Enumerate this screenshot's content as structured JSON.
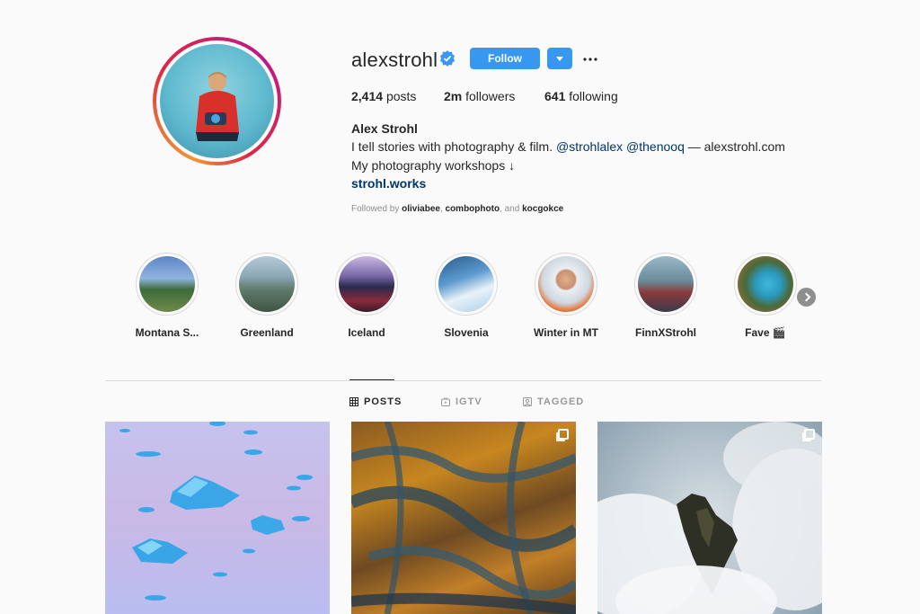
{
  "profile": {
    "username": "alexstrohl",
    "verified_icon": "verified-badge-icon",
    "follow_label": "Follow",
    "posts_count": "2,414",
    "posts_label": "posts",
    "followers_count": "2m",
    "followers_label": "followers",
    "following_count": "641",
    "following_label": "following",
    "full_name": "Alex Strohl",
    "bio_line1_prefix": "I tell stories with photography & film. ",
    "mention1": "@strohlalex",
    "mention2": "@thenooq",
    "bio_line1_suffix": " — alexstrohl.com",
    "bio_line2": "My photography workshops ↓",
    "link": "strohl.works",
    "followed_by_prefix": "Followed by ",
    "followed_by_1": "oliviabee",
    "followed_by_2": "combophoto",
    "followed_by_3": "kocgokce",
    "followed_by_sep": ", ",
    "followed_by_and": ", and "
  },
  "highlights": [
    {
      "label": "Montana S..."
    },
    {
      "label": "Greenland"
    },
    {
      "label": "Iceland"
    },
    {
      "label": "Slovenia"
    },
    {
      "label": "Winter in MT"
    },
    {
      "label": "FinnXStrohl"
    },
    {
      "label": "Fave 🎬"
    }
  ],
  "tabs": [
    {
      "label": "POSTS",
      "icon": "grid-icon",
      "active": true
    },
    {
      "label": "IGTV",
      "icon": "igtv-icon",
      "active": false
    },
    {
      "label": "TAGGED",
      "icon": "tagged-icon",
      "active": false
    }
  ],
  "colors": {
    "accent": "#3897f0",
    "link": "#003569",
    "text": "#262626",
    "muted": "#8e8e8e"
  }
}
